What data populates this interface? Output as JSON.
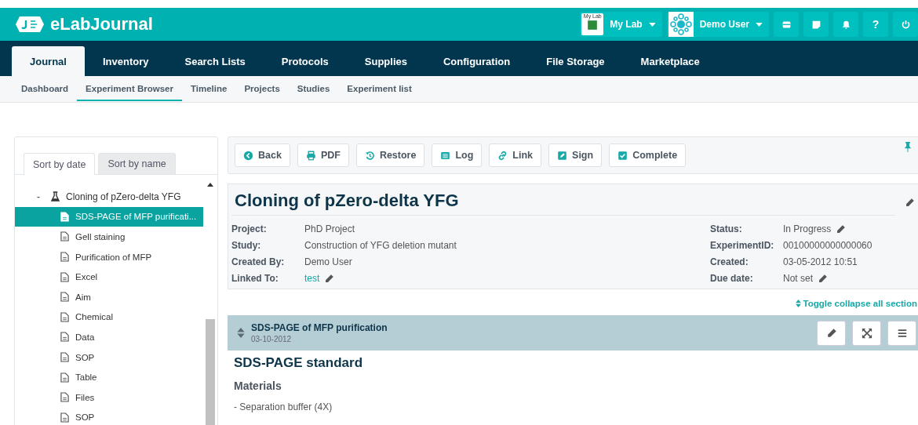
{
  "header": {
    "logo": "eLabJournal",
    "lab": {
      "badge": "My Lab",
      "label": "My Lab"
    },
    "user": {
      "label": "Demo User"
    },
    "actions": [
      {
        "kind": "store"
      },
      {
        "kind": "note"
      },
      {
        "kind": "bell"
      },
      {
        "kind": "text",
        "text": "?"
      },
      {
        "kind": "power"
      }
    ]
  },
  "main_tabs": [
    {
      "label": "Journal",
      "selected": true
    },
    {
      "label": "Inventory",
      "selected": false
    },
    {
      "label": "Search Lists",
      "selected": false
    },
    {
      "label": "Protocols",
      "selected": false
    },
    {
      "label": "Supplies",
      "selected": false
    },
    {
      "label": "Configuration",
      "selected": false
    },
    {
      "label": "File Storage",
      "selected": false
    },
    {
      "label": "Marketplace",
      "selected": false
    }
  ],
  "sub_tabs": [
    {
      "label": "Dashboard",
      "selected": false
    },
    {
      "label": "Experiment Browser",
      "selected": true
    },
    {
      "label": "Timeline",
      "selected": false
    },
    {
      "label": "Projects",
      "selected": false
    },
    {
      "label": "Studies",
      "selected": false
    },
    {
      "label": "Experiment list",
      "selected": false
    }
  ],
  "sidebar": {
    "sort_tabs": [
      {
        "label": "Sort by date",
        "selected": true
      },
      {
        "label": "Sort by name",
        "selected": false
      }
    ],
    "tree": [
      {
        "label": "Cloning of pZero-delta YFG",
        "toggle": "-",
        "children": [
          {
            "label": "SDS-PAGE of MFP purificati...",
            "selected": true
          },
          {
            "label": "Gell staining",
            "selected": false
          },
          {
            "label": "Purification of MFP",
            "selected": false
          },
          {
            "label": "Excel",
            "selected": false
          },
          {
            "label": "Aim",
            "selected": false
          },
          {
            "label": "Chemical",
            "selected": false
          },
          {
            "label": "Data",
            "selected": false
          },
          {
            "label": "SOP",
            "selected": false
          },
          {
            "label": "Table",
            "selected": false
          },
          {
            "label": "Files",
            "selected": false
          },
          {
            "label": "SOP",
            "selected": false
          }
        ]
      }
    ]
  },
  "toolbar": {
    "buttons": [
      {
        "label": "Back",
        "kind": "back"
      },
      {
        "label": "PDF",
        "kind": "print"
      },
      {
        "label": "Restore",
        "kind": "history"
      },
      {
        "label": "Log",
        "kind": "list"
      },
      {
        "label": "Link",
        "kind": "link"
      },
      {
        "label": "Sign",
        "kind": "sign"
      },
      {
        "label": "Complete",
        "kind": "check"
      }
    ]
  },
  "experiment": {
    "title": "Cloning of pZero-delta YFG",
    "fields_left": [
      {
        "label": "Project:",
        "value": "PhD Project",
        "kind": "text",
        "editable": false
      },
      {
        "label": "Study:",
        "value": "Construction of YFG deletion mutant",
        "kind": "text",
        "editable": false
      },
      {
        "label": "Created By:",
        "value": "Demo User",
        "kind": "text",
        "editable": false
      },
      {
        "label": "Linked To:",
        "value": "test",
        "kind": "link",
        "editable": true
      }
    ],
    "fields_right": [
      {
        "label": "Status:",
        "value": "In Progress",
        "kind": "text",
        "editable": true
      },
      {
        "label": "ExperimentID:",
        "value": "00100000000000060",
        "kind": "text",
        "editable": false
      },
      {
        "label": "Created:",
        "value": "03-05-2012 10:51",
        "kind": "text",
        "editable": false
      },
      {
        "label": "Due date:",
        "value": "Not set",
        "kind": "text",
        "editable": true
      }
    ]
  },
  "toggle_all": "Toggle collapse all section",
  "section": {
    "title": "SDS-PAGE of MFP purification",
    "date": "03-10-2012",
    "heading": "SDS-PAGE standard",
    "subheading": "Materials",
    "lines": [
      "- Separation buffer (4X)"
    ]
  }
}
